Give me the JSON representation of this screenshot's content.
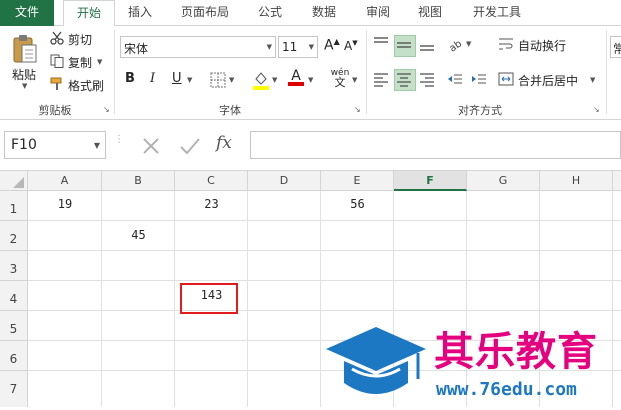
{
  "tabs": [
    "文件",
    "开始",
    "插入",
    "页面布局",
    "公式",
    "数据",
    "审阅",
    "视图",
    "开发工具"
  ],
  "active_tab": "开始",
  "clipboard": {
    "paste": "粘贴",
    "cut": "剪切",
    "copy": "复制",
    "format_painter": "格式刷",
    "group": "剪贴板"
  },
  "font": {
    "name": "宋体",
    "size": "11",
    "group": "字体",
    "bold": "B",
    "italic": "I",
    "underline": "U",
    "grow": "A",
    "shrink": "A",
    "font_color": "A",
    "phonetic": "wén",
    "phonetic_sub": "文"
  },
  "alignment": {
    "wrap": "自动换行",
    "merge": "合并后居中",
    "group": "对齐方式"
  },
  "number_format_partial": "常",
  "formula_bar": {
    "name_box": "F10",
    "fx": "fx",
    "value": ""
  },
  "columns": [
    "A",
    "B",
    "C",
    "D",
    "E",
    "F",
    "G",
    "H"
  ],
  "selected_column": "F",
  "rows": [
    "1",
    "2",
    "3",
    "4",
    "5",
    "6",
    "7"
  ],
  "cells": {
    "A1": "19",
    "C1": "23",
    "E1": "56",
    "B2": "45",
    "C4": "143"
  },
  "watermark": {
    "brand": "其乐教育",
    "url": "www.76edu.com"
  },
  "colors": {
    "accent": "#217346",
    "highlight_box": "#e21c1c",
    "watermark_blue": "#1d78c4",
    "watermark_pink": "#e4007f"
  }
}
